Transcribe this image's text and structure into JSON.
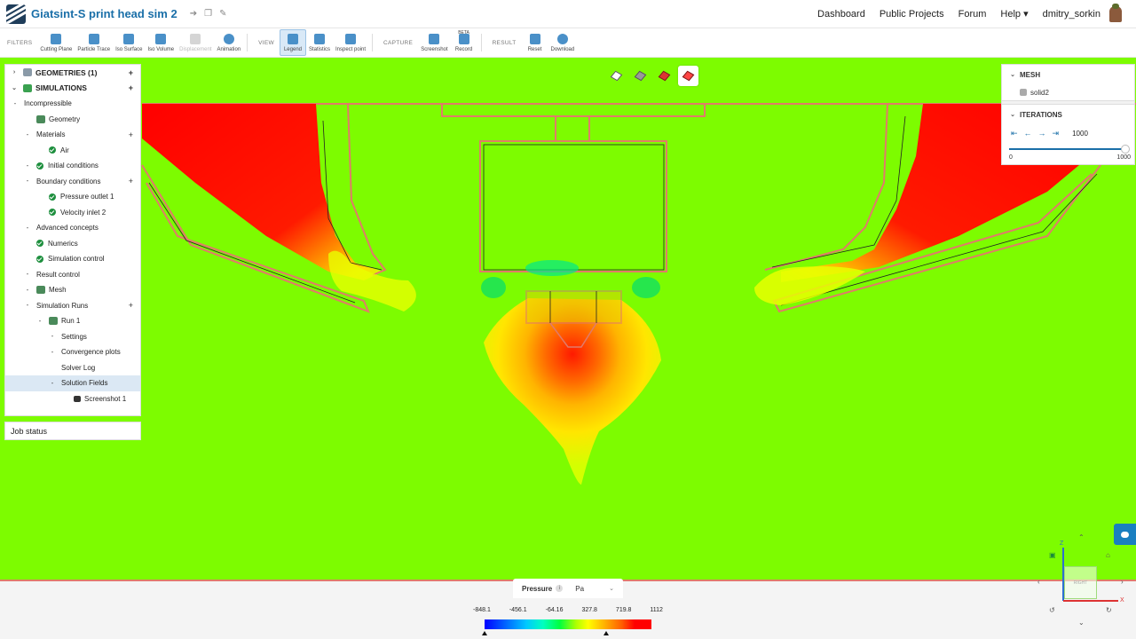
{
  "app": {
    "project_title": "Giatsint-S print head sim 2",
    "nav": [
      "Dashboard",
      "Public Projects",
      "Forum",
      "Help ▾",
      "dmitry_sorkin"
    ]
  },
  "toolbar": {
    "filters_label": "FILTERS",
    "filters": [
      {
        "label": "Cutting Plane",
        "icon": "cutting-plane-icon"
      },
      {
        "label": "Particle Trace",
        "icon": "particle-trace-icon"
      },
      {
        "label": "Iso Surface",
        "icon": "iso-surface-icon"
      },
      {
        "label": "Iso Volume",
        "icon": "iso-volume-icon"
      },
      {
        "label": "Displacement",
        "icon": "displacement-icon",
        "disabled": true
      },
      {
        "label": "Animation",
        "icon": "animation-icon"
      }
    ],
    "view_label": "VIEW",
    "view": [
      {
        "label": "Legend",
        "icon": "legend-icon",
        "active": true
      },
      {
        "label": "Statistics",
        "icon": "statistics-icon"
      },
      {
        "label": "Inspect point",
        "icon": "inspect-point-icon"
      }
    ],
    "capture_label": "CAPTURE",
    "capture": [
      {
        "label": "Screenshot",
        "icon": "camera-icon"
      },
      {
        "label": "Record",
        "icon": "record-icon",
        "badge": "BETA"
      }
    ],
    "result_label": "RESULT",
    "result": [
      {
        "label": "Reset",
        "icon": "reset-icon"
      },
      {
        "label": "Download",
        "icon": "download-icon"
      }
    ]
  },
  "tree": {
    "geometries": "GEOMETRIES (1)",
    "simulations": "SIMULATIONS",
    "items": [
      {
        "label": "Incompressible",
        "indent": 0,
        "type": "minus"
      },
      {
        "label": "Geometry",
        "indent": 1,
        "type": "gicon"
      },
      {
        "label": "Materials",
        "indent": 1,
        "type": "minus",
        "plus": true
      },
      {
        "label": "Air",
        "indent": 2,
        "type": "check"
      },
      {
        "label": "Initial conditions",
        "indent": 1,
        "type": "minus-check"
      },
      {
        "label": "Boundary conditions",
        "indent": 1,
        "type": "minus",
        "plus": true
      },
      {
        "label": "Pressure outlet 1",
        "indent": 2,
        "type": "check"
      },
      {
        "label": "Velocity inlet 2",
        "indent": 2,
        "type": "check"
      },
      {
        "label": "Advanced concepts",
        "indent": 1,
        "type": "minus"
      },
      {
        "label": "Numerics",
        "indent": 1,
        "type": "check"
      },
      {
        "label": "Simulation control",
        "indent": 1,
        "type": "check"
      },
      {
        "label": "Result control",
        "indent": 1,
        "type": "minus"
      },
      {
        "label": "Mesh",
        "indent": 1,
        "type": "minus-gicon"
      },
      {
        "label": "Simulation Runs",
        "indent": 1,
        "type": "minus",
        "plus": true
      },
      {
        "label": "Run 1",
        "indent": 2,
        "type": "minus-gicon"
      },
      {
        "label": "Settings",
        "indent": 3,
        "type": "minus"
      },
      {
        "label": "Convergence plots",
        "indent": 3,
        "type": "minus"
      },
      {
        "label": "Solver Log",
        "indent": 3,
        "type": "none"
      },
      {
        "label": "Solution Fields",
        "indent": 3,
        "type": "minus",
        "selected": true
      },
      {
        "label": "Screenshot 1",
        "indent": 4,
        "type": "camera"
      }
    ]
  },
  "job_status": "Job status",
  "mesh_panel": {
    "title": "MESH",
    "item": "solid2"
  },
  "iterations_panel": {
    "title": "ITERATIONS",
    "value": "1000",
    "min": "0",
    "max": "1000",
    "fraction": 1.0
  },
  "legend": {
    "field": "Pressure",
    "unit": "Pa",
    "ticks": [
      "-848.1",
      "-456.1",
      "-64.16",
      "327.8",
      "719.8",
      "1112"
    ],
    "markers": [
      0.0,
      0.73
    ]
  },
  "gizmo": {
    "z": "Z",
    "x": "X",
    "face": "RIGHT"
  },
  "colors": {
    "accent": "#1a6fa8",
    "field_green": "#7dfc00",
    "high": "#ff0000",
    "low": "#0000ff"
  }
}
